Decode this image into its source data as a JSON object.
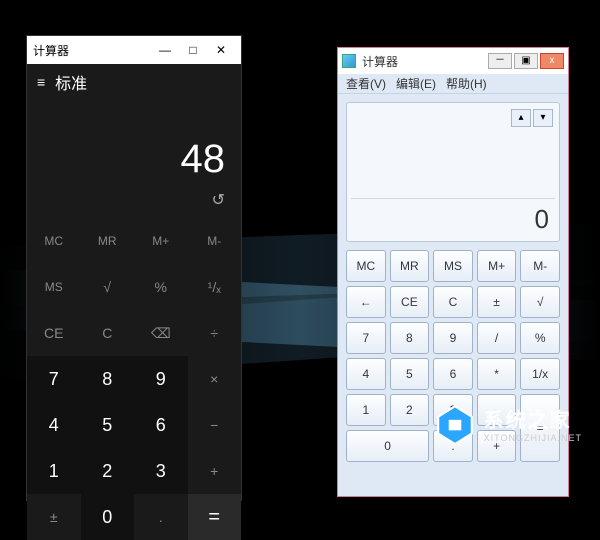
{
  "modern_calc": {
    "title": "计算器",
    "window_buttons": {
      "minimize": "—",
      "maximize": "□",
      "close": "✕"
    },
    "hamburger": "≡",
    "mode": "标准",
    "display_value": "48",
    "history_icon": "↺",
    "buttons": {
      "mc": "MC",
      "mr": "MR",
      "mplus": "M+",
      "mminus": "M-",
      "ms": "MS",
      "sqrt": "√",
      "percent": "%",
      "reciprocal": "¹/ₓ",
      "ce": "CE",
      "c": "C",
      "back": "⌫",
      "div": "÷",
      "7": "7",
      "8": "8",
      "9": "9",
      "mul": "×",
      "4": "4",
      "5": "5",
      "6": "6",
      "sub": "−",
      "1": "1",
      "2": "2",
      "3": "3",
      "add": "+",
      "plusminus": "±",
      "0": "0",
      "dot": ".",
      "eq": "="
    }
  },
  "win7_calc": {
    "title": "计算器",
    "window_buttons": {
      "minimize": "－",
      "maximize": "▣",
      "close": "x"
    },
    "menu": {
      "view": "查看(V)",
      "edit": "编辑(E)",
      "help": "帮助(H)"
    },
    "display_value": "0",
    "hist_up": "▴",
    "hist_down": "▾",
    "buttons": {
      "mc": "MC",
      "mr": "MR",
      "ms": "MS",
      "mplus": "M+",
      "mminus": "M-",
      "back": "←",
      "ce": "CE",
      "c": "C",
      "plusminus": "±",
      "sqrt": "√",
      "7": "7",
      "8": "8",
      "9": "9",
      "div": "/",
      "percent": "%",
      "4": "4",
      "5": "5",
      "6": "6",
      "mul": "*",
      "reciprocal": "1/x",
      "1": "1",
      "2": "2",
      "3": "3",
      "sub": "-",
      "eq": "=",
      "0": "0",
      "dot": ".",
      "add": "+"
    }
  },
  "watermark": {
    "cn": "系统之家",
    "en": "XITONGZHIJIA.NET"
  }
}
